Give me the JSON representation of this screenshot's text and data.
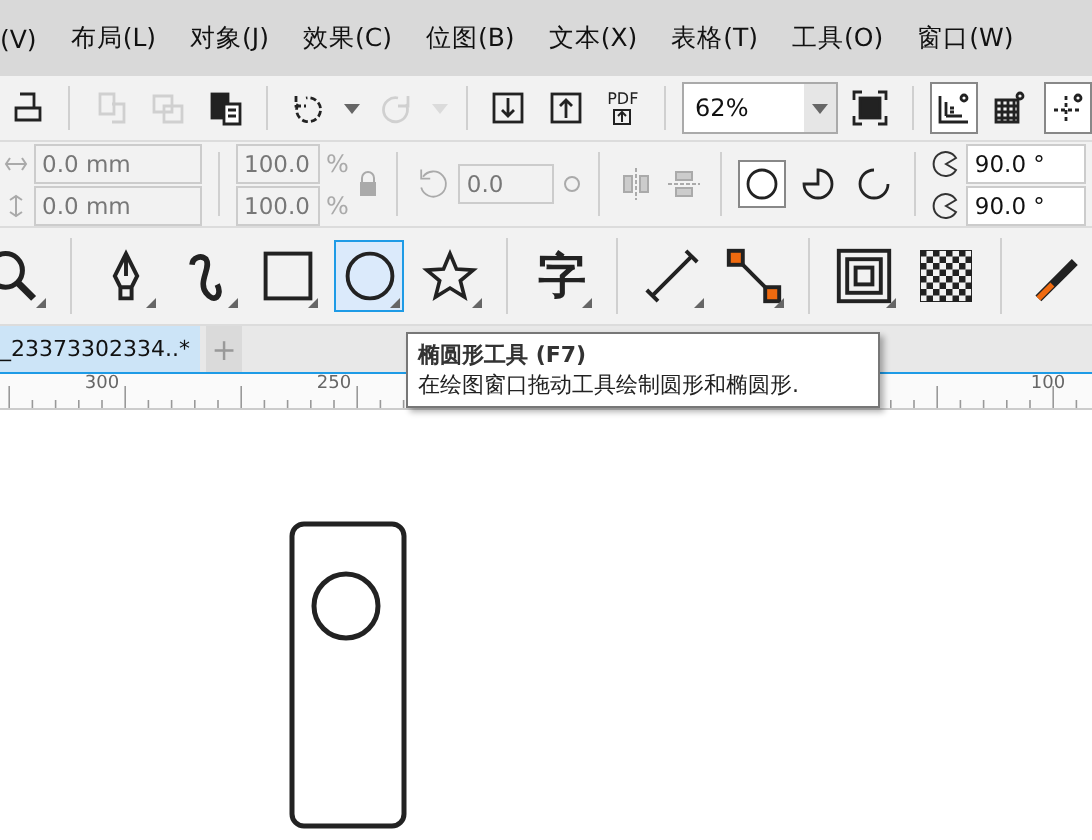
{
  "menu": [
    "(V)",
    "布局(L)",
    "对象(J)",
    "效果(C)",
    "位图(B)",
    "文本(X)",
    "表格(T)",
    "工具(O)",
    "窗口(W)"
  ],
  "standard_toolbar": [
    {
      "kind": "print",
      "disabled": false,
      "on": false
    },
    {
      "kind": "sep"
    },
    {
      "kind": "copy",
      "disabled": true,
      "on": false
    },
    {
      "kind": "copy2",
      "disabled": true,
      "on": false
    },
    {
      "kind": "paste",
      "disabled": false,
      "on": false
    },
    {
      "kind": "sep"
    },
    {
      "kind": "undo",
      "disabled": false,
      "on": false
    },
    {
      "kind": "caret",
      "disabled": false,
      "on": false
    },
    {
      "kind": "redo",
      "disabled": true,
      "on": false
    },
    {
      "kind": "caret",
      "disabled": true,
      "on": false
    },
    {
      "kind": "sep"
    },
    {
      "kind": "import",
      "disabled": false,
      "on": false
    },
    {
      "kind": "export",
      "disabled": false,
      "on": false
    },
    {
      "kind": "pdf",
      "label": "PDF"
    },
    {
      "kind": "sep"
    },
    {
      "kind": "zoom",
      "value": "62%"
    },
    {
      "kind": "fullscreen",
      "disabled": false,
      "on": false
    },
    {
      "kind": "sep"
    },
    {
      "kind": "rulers",
      "disabled": false,
      "on": true
    },
    {
      "kind": "grid",
      "disabled": false,
      "on": false
    },
    {
      "kind": "guides",
      "disabled": false,
      "on": true
    }
  ],
  "property_bar": {
    "position": [
      "0.0 mm",
      "0.0 mm"
    ],
    "scale": [
      "100.0",
      "100.0"
    ],
    "scale_unit": [
      "%",
      "%"
    ],
    "rotation": "0.0",
    "angles": [
      "90.0 °",
      "90.0 °"
    ],
    "ellipse_modes": [
      {
        "kind": "ellipse",
        "selected": true
      },
      {
        "kind": "pie",
        "selected": false
      },
      {
        "kind": "arc",
        "selected": false
      }
    ]
  },
  "toolbox": [
    {
      "kind": "zoom",
      "selected": false,
      "flyout": true
    },
    {
      "kind": "sep"
    },
    {
      "kind": "pen",
      "selected": false,
      "flyout": true
    },
    {
      "kind": "curve",
      "selected": false,
      "flyout": true
    },
    {
      "kind": "rect",
      "selected": false,
      "flyout": true
    },
    {
      "kind": "ellipse",
      "selected": true,
      "flyout": true
    },
    {
      "kind": "star",
      "selected": false,
      "flyout": true
    },
    {
      "kind": "sep"
    },
    {
      "kind": "text",
      "glyph": "字",
      "selected": false,
      "flyout": true
    },
    {
      "kind": "sep"
    },
    {
      "kind": "dimension",
      "selected": false,
      "flyout": true
    },
    {
      "kind": "connector",
      "selected": false,
      "flyout": true
    },
    {
      "kind": "sep"
    },
    {
      "kind": "contour",
      "selected": false,
      "flyout": true
    },
    {
      "kind": "transparency",
      "selected": false
    },
    {
      "kind": "sep"
    },
    {
      "kind": "eyedropper",
      "selected": false
    }
  ],
  "document_tab": {
    "title": "_23373302334..*",
    "add": "+"
  },
  "ruler": {
    "labels": [
      "300",
      "250",
      "100"
    ]
  },
  "tooltip": {
    "title": "椭圆形工具 (F7)",
    "description": "在绘图窗口拖动工具绘制圆形和椭圆形."
  }
}
